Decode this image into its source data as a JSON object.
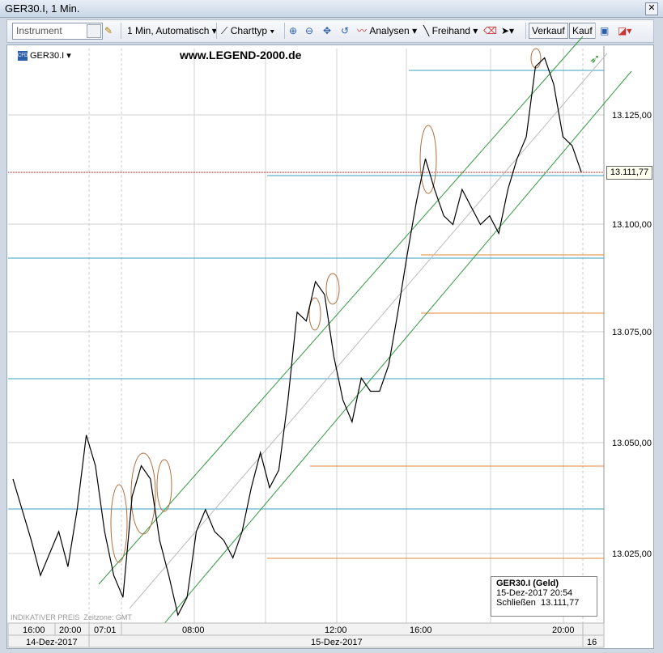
{
  "window": {
    "title": "GER30.I, 1 Min."
  },
  "toolbar": {
    "instrument_placeholder": "Instrument",
    "interval": "1 Min, Automatisch",
    "charttype": "Charttyp",
    "analysen": "Analysen",
    "freihand": "Freihand",
    "verkauf": "Verkauf",
    "kauf": "Kauf"
  },
  "chart": {
    "symbol": "GER30.I",
    "watermark": "www.LEGEND-2000.de",
    "indicative": "INDIKATIVER PREIS",
    "timezone": "Zeitzone: GMT",
    "current_price": "13.111,77",
    "y_labels": [
      "13.125,00",
      "13.100,00",
      "13.075,00",
      "13.050,00",
      "13.025,00"
    ],
    "time_labels": [
      "16:00",
      "20:00",
      "07:01",
      "08:00",
      "12:00",
      "16:00",
      "20:00"
    ],
    "date_labels": [
      "14-Dez-2017",
      "15-Dez-2017",
      "16"
    ]
  },
  "infobox": {
    "title": "GER30.I (Geld)",
    "date": "15-Dez-2017 20:54",
    "close_label": "Schließen",
    "close_value": "13.111,77"
  },
  "colors": {
    "horizontal_blue": "#3a9fc0",
    "horizontal_orange": "#e08a3a",
    "channel_green": "#2e9a3e",
    "price_line": "#000000",
    "current_marker": "#cc0000"
  },
  "chart_data": {
    "type": "line",
    "series": [
      {
        "values": [
          13042,
          13035,
          13028,
          13020,
          13025,
          13030,
          13022,
          13035,
          13052,
          13045,
          13030,
          13020,
          13015,
          13038,
          13045,
          13042,
          13028,
          13020,
          13010,
          13015,
          13030,
          13035,
          13030,
          13028,
          13024,
          13030,
          13040,
          13048,
          13040,
          13044,
          13060,
          13080,
          13078,
          13087,
          13084,
          13070,
          13060,
          13055,
          13065,
          13062,
          13062,
          13068,
          13080,
          13093,
          13105,
          13115,
          13108,
          13102,
          13100,
          13108,
          13104,
          13100,
          13102,
          13098,
          13108,
          13115,
          13120,
          13136,
          13138,
          13132,
          13120,
          13118,
          13112
        ]
      }
    ],
    "ylim": [
      13006,
      13142
    ]
  }
}
